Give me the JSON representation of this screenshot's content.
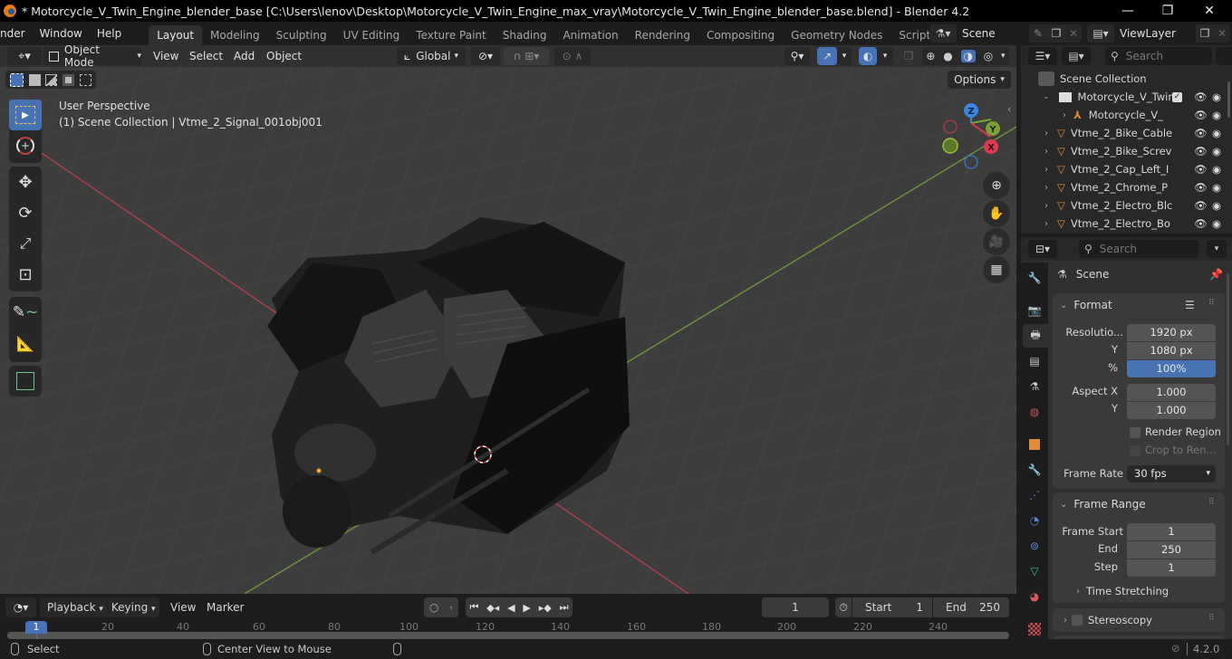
{
  "window": {
    "title": "* Motorcycle_V_Twin_Engine_blender_base [C:\\Users\\lenov\\Desktop\\Motorcycle_V_Twin_Engine_max_vray\\Motorcycle_V_Twin_Engine_blender_base.blend] - Blender 4.2",
    "minimize": "—",
    "maximize": "❐",
    "close": "✕"
  },
  "menu": [
    "nder",
    "Window",
    "Help"
  ],
  "workspaces": [
    "Layout",
    "Modeling",
    "Sculpting",
    "UV Editing",
    "Texture Paint",
    "Shading",
    "Animation",
    "Rendering",
    "Compositing",
    "Geometry Nodes",
    "Scripting"
  ],
  "workspace_add": "+",
  "scene_selector": {
    "value": "Scene"
  },
  "viewlayer_selector": {
    "value": "ViewLayer"
  },
  "viewport": {
    "mode": "Object Mode",
    "menus": [
      "View",
      "Select",
      "Add",
      "Object"
    ],
    "transform_orientation": "Global",
    "options_label": "Options",
    "overlay_title": "User Perspective",
    "overlay_subtitle": "(1) Scene Collection | Vtme_2_Signal_001obj001",
    "gizmo": {
      "z": "Z",
      "y": "Y",
      "x": "X"
    },
    "colors": {
      "x_axis": "#d9374f",
      "y_axis": "#7aa235",
      "z_axis": "#3a87e0",
      "active": "#4772b3"
    }
  },
  "outliner": {
    "search_placeholder": "Search",
    "root": "Scene Collection",
    "items": [
      {
        "label": "Motorcycle_V_Twir",
        "type": "collection",
        "expanded": true,
        "checked": true
      },
      {
        "label": "Motorcycle_V_",
        "type": "empty",
        "indent": true
      },
      {
        "label": "Vtme_2_Bike_Cable",
        "type": "mesh"
      },
      {
        "label": "Vtme_2_Bike_Screv",
        "type": "mesh"
      },
      {
        "label": "Vtme_2_Cap_Left_I",
        "type": "mesh"
      },
      {
        "label": "Vtme_2_Chrome_P",
        "type": "mesh"
      },
      {
        "label": "Vtme_2_Electro_Blc",
        "type": "mesh"
      },
      {
        "label": "Vtme_2_Electro_Bo",
        "type": "mesh"
      }
    ]
  },
  "properties": {
    "search_placeholder": "Search",
    "context": "Scene",
    "format": {
      "title": "Format",
      "resolution_x_label": "Resolutio...",
      "resolution_x": "1920 px",
      "resolution_y_label": "Y",
      "resolution_y": "1080 px",
      "percent_label": "%",
      "percent": "100%",
      "aspect_x_label": "Aspect X",
      "aspect_x": "1.000",
      "aspect_y_label": "Y",
      "aspect_y": "1.000",
      "render_region": "Render Region",
      "crop": "Crop to Ren...",
      "frame_rate_label": "Frame Rate",
      "frame_rate": "30 fps"
    },
    "frame_range": {
      "title": "Frame Range",
      "start_label": "Frame Start",
      "start": "1",
      "end_label": "End",
      "end": "250",
      "step_label": "Step",
      "step": "1",
      "time_stretching": "Time Stretching"
    },
    "stereoscopy": "Stereoscopy"
  },
  "timeline": {
    "menus": [
      "Playback",
      "Keying",
      "View",
      "Marker"
    ],
    "current_frame": "1",
    "start_label": "Start",
    "start": "1",
    "end_label": "End",
    "end": "250",
    "ruler": [
      "20",
      "40",
      "60",
      "80",
      "100",
      "120",
      "140",
      "160",
      "180",
      "200",
      "220",
      "240"
    ],
    "playhead": "1"
  },
  "status": {
    "select": "Select",
    "center_view": "Center View to Mouse",
    "version": "4.2.0"
  }
}
